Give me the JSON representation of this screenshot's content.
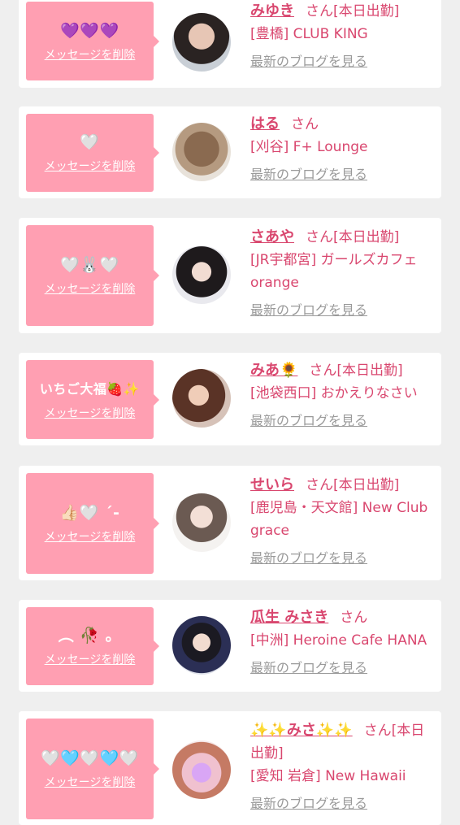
{
  "delete_label": "メッセージを削除",
  "blog_label": "最新のブログを見る",
  "san_label": "さん",
  "colors": {
    "accent": "#d9476f",
    "bubble": "#ff9fb2",
    "link_gray": "#9a9a9a",
    "bg": "#efefef"
  },
  "cards": [
    {
      "message": "💜💜💜",
      "name": "みゆき",
      "status": "[本日出勤]",
      "shop": "[豊橋] CLUB KING"
    },
    {
      "message": "🤍",
      "name": "はる",
      "status": "",
      "shop": "[刈谷] F+ Lounge"
    },
    {
      "message": "🤍🐰🤍",
      "name": "さあや",
      "status": "[本日出勤]",
      "shop": "[JR宇都宮] ガールズカフェ orange"
    },
    {
      "message": "いちご大福🍓✨",
      "name": "みあ🌻",
      "status": "[本日出勤]",
      "shop": "[池袋西口] おかえりなさい"
    },
    {
      "message": "👍🏻🤍 ˊ-",
      "name": "せいら",
      "status": "[本日出勤]",
      "shop": "[鹿児島・天文館] New Club grace"
    },
    {
      "message": "︵ 🥀 。",
      "name": "瓜生 みさき",
      "status": "",
      "shop": "[中洲] Heroine Cafe HANA"
    },
    {
      "message": "🤍🩵🤍🩵🤍",
      "name": "✨✨みさ✨✨",
      "status": "[本日出勤]",
      "shop": "[愛知 岩倉] New Hawaii"
    }
  ]
}
